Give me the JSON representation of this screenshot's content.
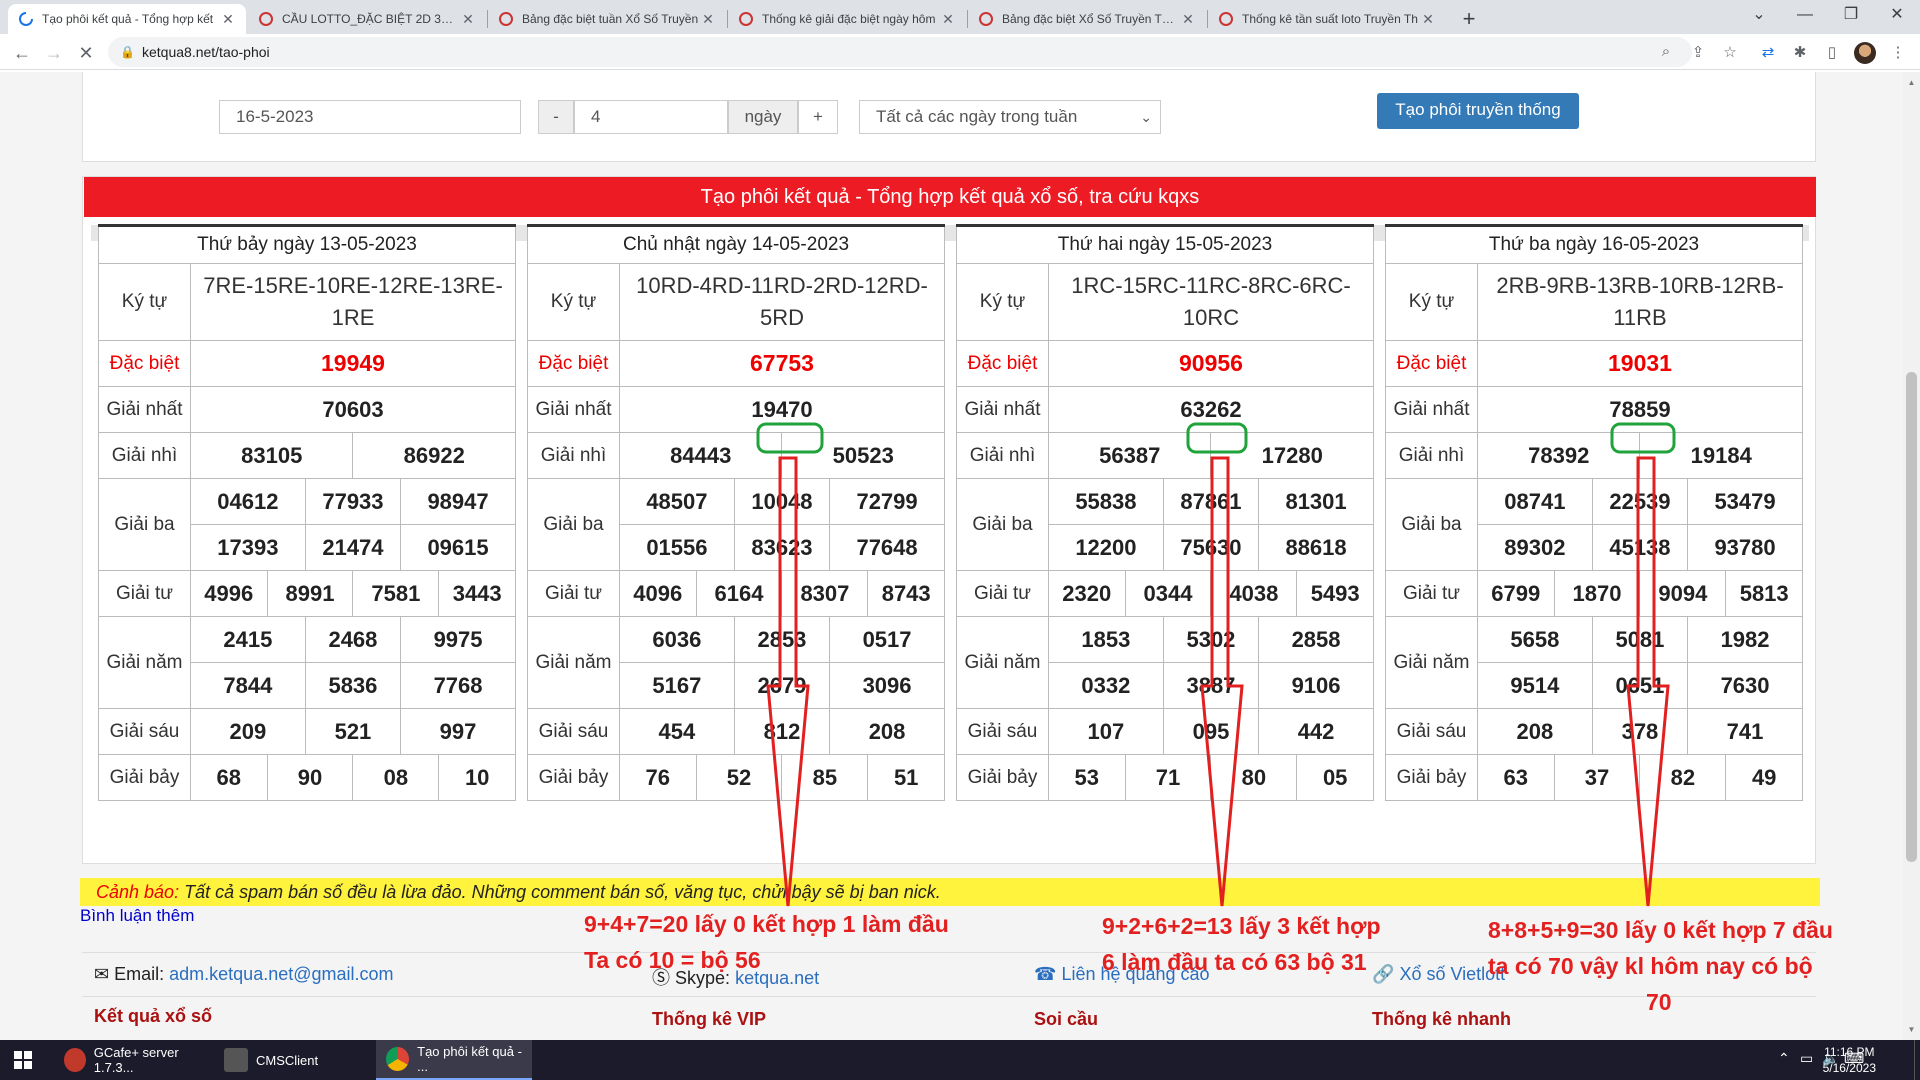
{
  "browser": {
    "tabs": [
      {
        "title": "Tạo phôi kết quả - Tổng hợp kết",
        "active": true
      },
      {
        "title": "CẦU LOTTO_ĐẶC BIỆT 2D 3D 4D",
        "active": false
      },
      {
        "title": "Bảng đặc biệt tuần Xổ Số Truyền",
        "active": false
      },
      {
        "title": "Thống kê giải đặc biệt ngày hôm",
        "active": false
      },
      {
        "title": "Bảng đặc biệt Xổ Số Truyền Thốn",
        "active": false
      },
      {
        "title": "Thống kê tần suất loto Truyền Th",
        "active": false
      }
    ],
    "url": "ketqua8.net/tao-phoi"
  },
  "form": {
    "date_value": "16-5-2023",
    "minus_label": "-",
    "days_value": "4",
    "days_unit": "ngày",
    "plus_label": "+",
    "weekday_select": "Tất cả các ngày trong tuần",
    "submit_label": "Tạo phôi truyền thống"
  },
  "results_title": "Tạo phôi kết quả - Tổng hợp kết quả xổ số, tra cứu kqxs",
  "labels": {
    "kytu": "Ký tự",
    "db": "Đặc biệt",
    "g1": "Giải nhất",
    "g2": "Giải nhì",
    "g3": "Giải ba",
    "g4": "Giải tư",
    "g5": "Giải năm",
    "g6": "Giải sáu",
    "g7": "Giải bảy"
  },
  "tables": [
    {
      "header": "Thứ bảy ngày 13-05-2023",
      "kytu": "7RE-15RE-10RE-12RE-13RE-1RE",
      "db": "19949",
      "g1": "70603",
      "g2": [
        "83105",
        "86922"
      ],
      "g3": [
        "04612",
        "77933",
        "98947",
        "17393",
        "21474",
        "09615"
      ],
      "g4": [
        "4996",
        "8991",
        "7581",
        "3443"
      ],
      "g5": [
        "2415",
        "2468",
        "9975",
        "7844",
        "5836",
        "7768"
      ],
      "g6": [
        "209",
        "521",
        "997"
      ],
      "g7": [
        "68",
        "90",
        "08",
        "10"
      ]
    },
    {
      "header": "Chủ nhật ngày 14-05-2023",
      "kytu": "10RD-4RD-11RD-2RD-12RD-5RD",
      "db": "67753",
      "g1": "19470",
      "g2": [
        "84443",
        "50523"
      ],
      "g3": [
        "48507",
        "10048",
        "72799",
        "01556",
        "83623",
        "77648"
      ],
      "g4": [
        "4096",
        "6164",
        "8307",
        "8743"
      ],
      "g5": [
        "6036",
        "2853",
        "0517",
        "5167",
        "2679",
        "3096"
      ],
      "g6": [
        "454",
        "812",
        "208"
      ],
      "g7": [
        "76",
        "52",
        "85",
        "51"
      ]
    },
    {
      "header": "Thứ hai ngày 15-05-2023",
      "kytu": "1RC-15RC-11RC-8RC-6RC-10RC",
      "db": "90956",
      "g1": "63262",
      "g2": [
        "56387",
        "17280"
      ],
      "g3": [
        "55838",
        "87861",
        "81301",
        "12200",
        "75630",
        "88618"
      ],
      "g4": [
        "2320",
        "0344",
        "4038",
        "5493"
      ],
      "g5": [
        "1853",
        "5302",
        "2858",
        "0332",
        "3887",
        "9106"
      ],
      "g6": [
        "107",
        "095",
        "442"
      ],
      "g7": [
        "53",
        "71",
        "80",
        "05"
      ]
    },
    {
      "header": "Thứ ba ngày 16-05-2023",
      "kytu": "2RB-9RB-13RB-10RB-12RB-11RB",
      "db": "19031",
      "g1": "78859",
      "g2": [
        "78392",
        "19184"
      ],
      "g3": [
        "08741",
        "22539",
        "53479",
        "89302",
        "45138",
        "93780"
      ],
      "g4": [
        "6799",
        "1870",
        "9094",
        "5813"
      ],
      "g5": [
        "5658",
        "5081",
        "1982",
        "9514",
        "0651",
        "7630"
      ],
      "g6": [
        "208",
        "378",
        "741"
      ],
      "g7": [
        "63",
        "37",
        "82",
        "49"
      ]
    }
  ],
  "warning": {
    "label": "Cảnh báo:",
    "text": "Tất cả spam bán số đều là lừa đảo. Những comment bán số, văng tục, chửi bậy sẽ bị ban nick."
  },
  "comment_link": "Bình luận thêm",
  "footer": {
    "email_label": "Email:",
    "email": "adm.ketqua.net@gmail.com",
    "skype_label": "Skype:",
    "skype": "ketqua.net",
    "ads": "Liên hệ quảng cáo",
    "vietlott": "Xổ số Vietlott",
    "col1": "Kết quả xổ số",
    "col2": "Thống kê VIP",
    "col3": "Soi cầu",
    "col4": "Thống kê nhanh"
  },
  "annotations": [
    {
      "line1": "9+4+7=20 lấy 0  kết hợp 1 làm đầu",
      "line2": "Ta có 10 = bộ 56"
    },
    {
      "line1": "9+2+6+2=13 lấy 3 kết hợp",
      "line2": "6 làm đầu ta có 63 bộ 31"
    },
    {
      "line1": "8+8+5+9=30 lấy 0 kết hợp 7 đầu",
      "line2": "ta có 70 vậy kl hôm nay có bộ",
      "line3": "70"
    }
  ],
  "annotation_color": "#e32020",
  "circle_color": "#1fa33a",
  "taskbar": {
    "items": [
      "GCafe+ server 1.7.3...",
      "CMSClient",
      "Tạo phôi kết quả - ..."
    ],
    "time": "11:16 PM",
    "date": "5/16/2023"
  }
}
